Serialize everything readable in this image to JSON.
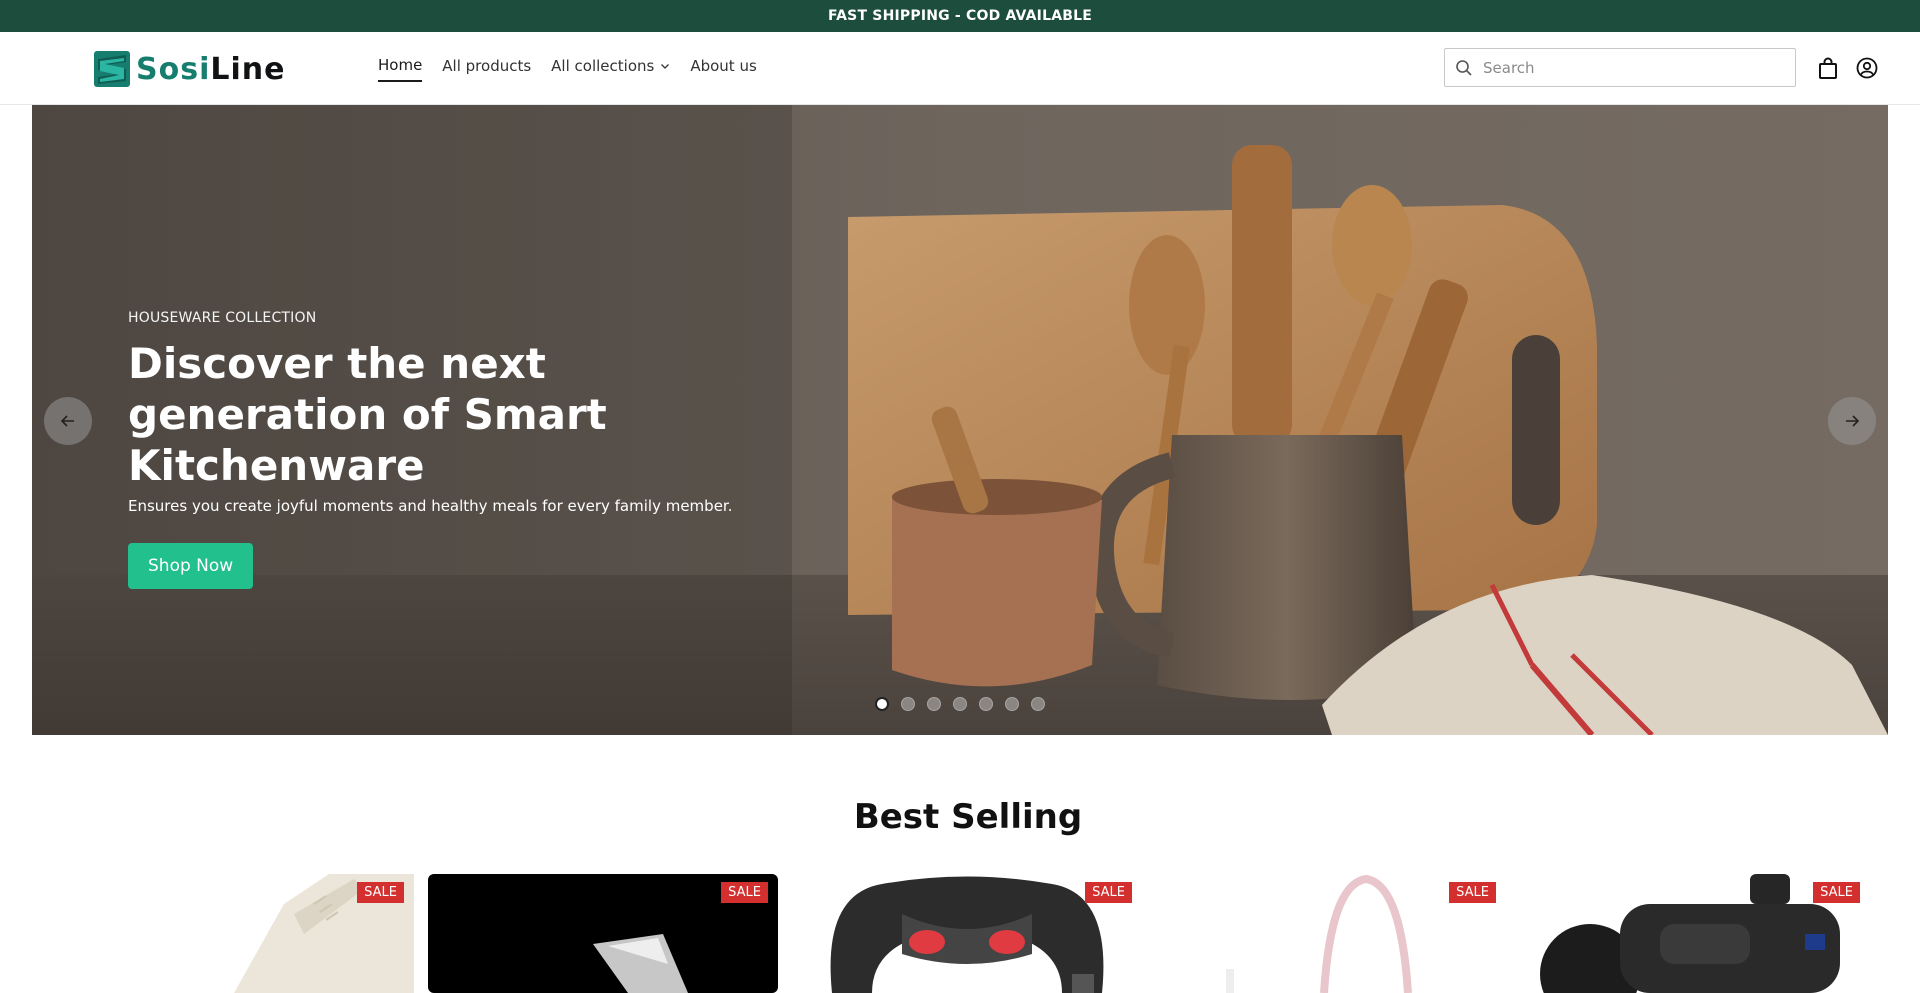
{
  "announcement": {
    "text": "FAST SHIPPING - COD AVAILABLE"
  },
  "brand": {
    "name_part1": "Sosi",
    "name_part2": "Line",
    "accent": "#167d6f"
  },
  "nav": {
    "items": [
      {
        "label": "Home",
        "active": true
      },
      {
        "label": "All products"
      },
      {
        "label": "All collections",
        "has_dropdown": true
      },
      {
        "label": "About us"
      }
    ]
  },
  "search": {
    "placeholder": "Search"
  },
  "header_icons": [
    "bag-icon",
    "account-icon"
  ],
  "hero": {
    "eyebrow": "HOUSEWARE COLLECTION",
    "title": "Discover the next generation of Smart Kitchenware",
    "subtitle": "Ensures you create joyful moments and healthy meals for every family member.",
    "button": "Shop Now",
    "button_color": "#22c08d",
    "slide_count": 7,
    "active_slide": 1
  },
  "best_selling": {
    "title": "Best Selling",
    "cards": [
      {
        "badge": "SALE"
      },
      {
        "badge": "SALE"
      },
      {
        "badge": "SALE"
      },
      {
        "badge": "SALE"
      },
      {
        "badge": "SALE"
      }
    ]
  }
}
